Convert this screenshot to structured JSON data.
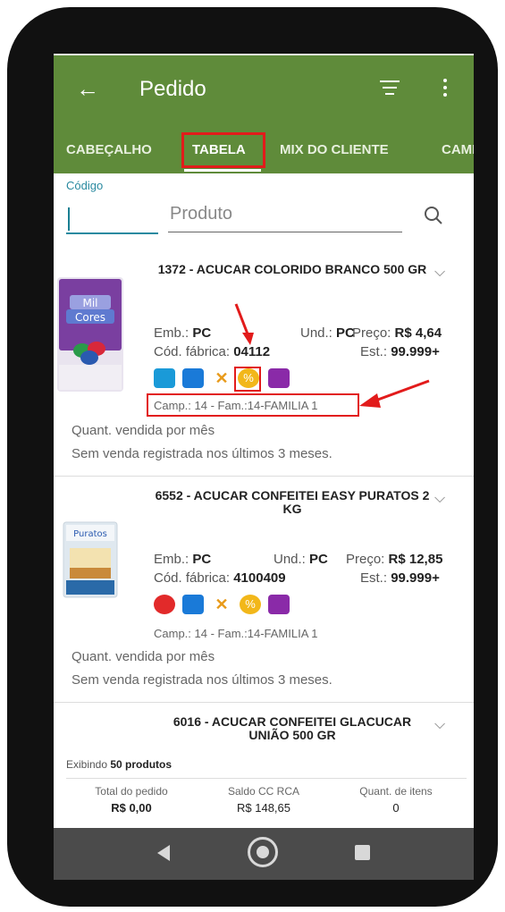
{
  "header": {
    "back_label": "←",
    "title": "Pedido"
  },
  "tabs": [
    {
      "label": "CABEÇALHO"
    },
    {
      "label": "TABELA",
      "active": true
    },
    {
      "label": "MIX DO CLIENTE"
    },
    {
      "label": "CAMP"
    }
  ],
  "search": {
    "codigo_label": "Código",
    "produto_placeholder": "Produto"
  },
  "products": [
    {
      "name": "1372 - ACUCAR COLORIDO BRANCO 500 GR",
      "emb_label": "Emb.:",
      "emb": "PC",
      "und_label": "Und.:",
      "und": "PC",
      "preco_label": "Preço:",
      "preco": "R$ 4,64",
      "cod_label": "Cód. fábrica:",
      "cod": "04112",
      "est_label": "Est.:",
      "est": "99.999+",
      "camp": "Camp.: 14 - Fam.:14-FAMILIA 1",
      "sold_label": "Quant. vendida por mês",
      "sold_note": "Sem venda registrada nos últimos 3 meses.",
      "thumb_brand_1": "Mil",
      "thumb_brand_2": "Cores",
      "icons": [
        "gift-icon",
        "calendar-icon",
        "cart-off-icon",
        "discount-icon",
        "combo-icon"
      ]
    },
    {
      "name": "6552 - ACUCAR CONFEITEI EASY PURATOS 2 KG",
      "emb_label": "Emb.:",
      "emb": "PC",
      "und_label": "Und.:",
      "und": "PC",
      "preco_label": "Preço:",
      "preco": "R$ 12,85",
      "cod_label": "Cód. fábrica:",
      "cod": "4100409",
      "est_label": "Est.:",
      "est": "99.999+",
      "camp": "Camp.: 14 - Fam.:14-FAMILIA 1",
      "sold_label": "Quant. vendida por mês",
      "sold_note": "Sem venda registrada nos últimos 3 meses.",
      "thumb_brand_1": "Puratos",
      "icons": [
        "eye-icon",
        "calendar-icon",
        "cart-off-icon",
        "discount-icon",
        "combo-icon"
      ]
    },
    {
      "name": "6016 - ACUCAR CONFEITEI GLACUCAR UNIÃO 500 GR"
    }
  ],
  "summary": {
    "exibindo_prefix": "Exibindo",
    "exibindo_count": "50 produtos",
    "total_label": "Total do pedido",
    "total_value": "R$ 0,00",
    "saldo_label": "Saldo CC RCA",
    "saldo_value": "R$ 148,65",
    "itens_label": "Quant. de itens",
    "itens_value": "0"
  },
  "colors": {
    "header": "#5f8b3a",
    "accent": "#2a8aa0",
    "highlight": "#e21b1b",
    "navbar": "#4b4b4b"
  }
}
